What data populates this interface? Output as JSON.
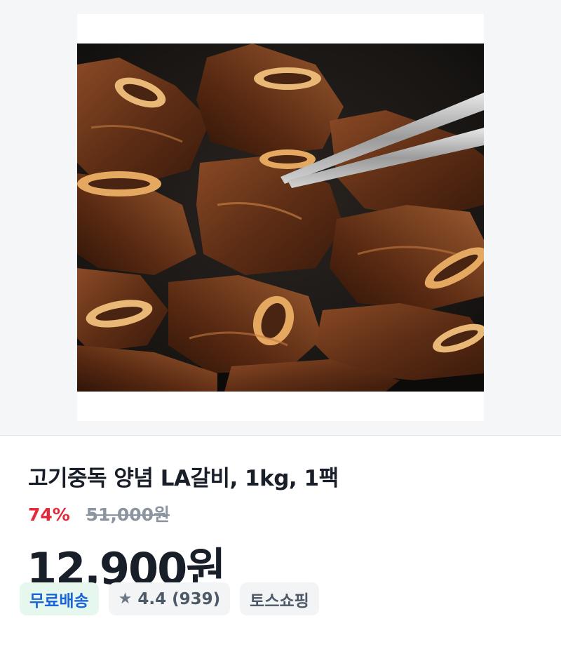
{
  "product": {
    "image_alt": "grilled marinated LA galbi short ribs in cast iron pan with tongs",
    "title": "고기중독 양념 LA갈비, 1kg, 1팩",
    "discount_rate": "74%",
    "original_price": "51,000원",
    "price": "12,900원"
  },
  "chips": {
    "shipping": "무료배송",
    "rating_icon": "star-icon",
    "rating": "4.4 (939)",
    "store": "토스쇼핑"
  },
  "colors": {
    "discount": "#e42939",
    "shipping_text": "#1b64da",
    "shipping_bg": "#e6f7ee",
    "chip_bg": "#f2f4f6"
  }
}
